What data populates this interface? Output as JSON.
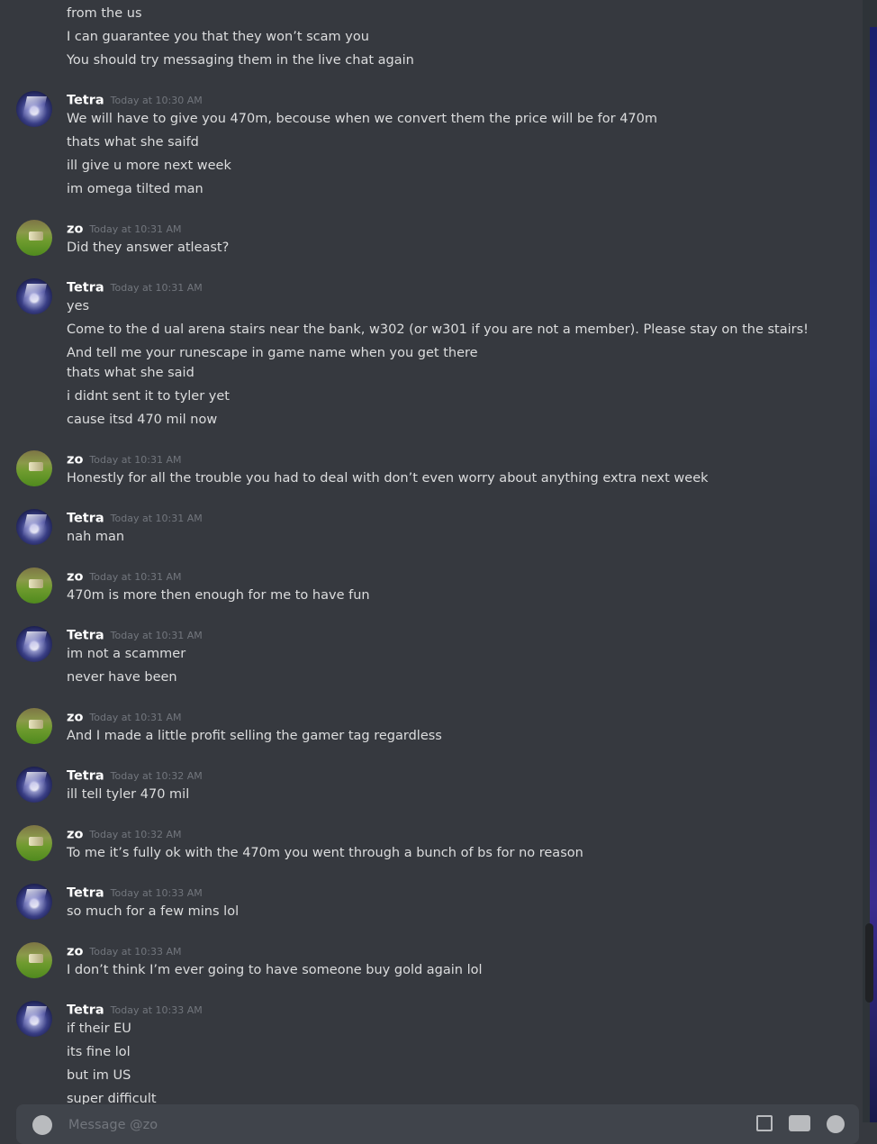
{
  "previous_lines": [
    "from the us",
    "I can guarantee you that they won’t scam you",
    "You should try messaging them in the live chat again"
  ],
  "messages": [
    {
      "author": "Tetra",
      "avatar": "tetra",
      "timestamp": "Today at 10:30 AM",
      "lines": [
        "We will have to give you 470m, becouse when we convert them the price will be for 470m",
        "thats what she saifd",
        "ill give u more next week",
        "im omega tilted man"
      ]
    },
    {
      "author": "zo",
      "avatar": "zo",
      "timestamp": "Today at 10:31 AM",
      "lines": [
        "Did they answer atleast?"
      ]
    },
    {
      "author": "Tetra",
      "avatar": "tetra",
      "timestamp": "Today at 10:31 AM",
      "lines": [
        "yes",
        "Come to the d ual arena stairs near the bank, w302 (or w301 if you are not a member). Please stay on the stairs! And tell me your runescape in game name when you get there",
        "thats what she said",
        "i didnt sent it to tyler yet",
        "cause itsd 470 mil now"
      ]
    },
    {
      "author": "zo",
      "avatar": "zo",
      "timestamp": "Today at 10:31 AM",
      "lines": [
        "Honestly for all the trouble you had to deal with don’t even worry about anything extra next week"
      ]
    },
    {
      "author": "Tetra",
      "avatar": "tetra",
      "timestamp": "Today at 10:31 AM",
      "lines": [
        "nah man"
      ]
    },
    {
      "author": "zo",
      "avatar": "zo",
      "timestamp": "Today at 10:31 AM",
      "lines": [
        "470m is more then enough for me to have fun"
      ]
    },
    {
      "author": "Tetra",
      "avatar": "tetra",
      "timestamp": "Today at 10:31 AM",
      "lines": [
        "im not a scammer",
        "never have been"
      ]
    },
    {
      "author": "zo",
      "avatar": "zo",
      "timestamp": "Today at 10:31 AM",
      "lines": [
        "And I made a little profit selling the gamer tag regardless"
      ]
    },
    {
      "author": "Tetra",
      "avatar": "tetra",
      "timestamp": "Today at 10:32 AM",
      "lines": [
        "ill tell tyler 470 mil"
      ]
    },
    {
      "author": "zo",
      "avatar": "zo",
      "timestamp": "Today at 10:32 AM",
      "lines": [
        "To me it’s fully ok with the 470m you went through a bunch of bs for no reason"
      ]
    },
    {
      "author": "Tetra",
      "avatar": "tetra",
      "timestamp": "Today at 10:33 AM",
      "lines": [
        "so much for a few mins lol"
      ]
    },
    {
      "author": "zo",
      "avatar": "zo",
      "timestamp": "Today at 10:33 AM",
      "lines": [
        "I don’t think I’m ever going to have someone buy gold again lol"
      ]
    },
    {
      "author": "Tetra",
      "avatar": "tetra",
      "timestamp": "Today at 10:33 AM",
      "lines": [
        "if their EU",
        "its fine lol",
        "but im US",
        "super difficult"
      ]
    }
  ],
  "composer": {
    "placeholder": "Message @zo"
  },
  "icons": {
    "attach": "plus-circle-icon",
    "gift": "gift-icon",
    "gif": "gif-icon",
    "emoji": "emoji-icon"
  }
}
